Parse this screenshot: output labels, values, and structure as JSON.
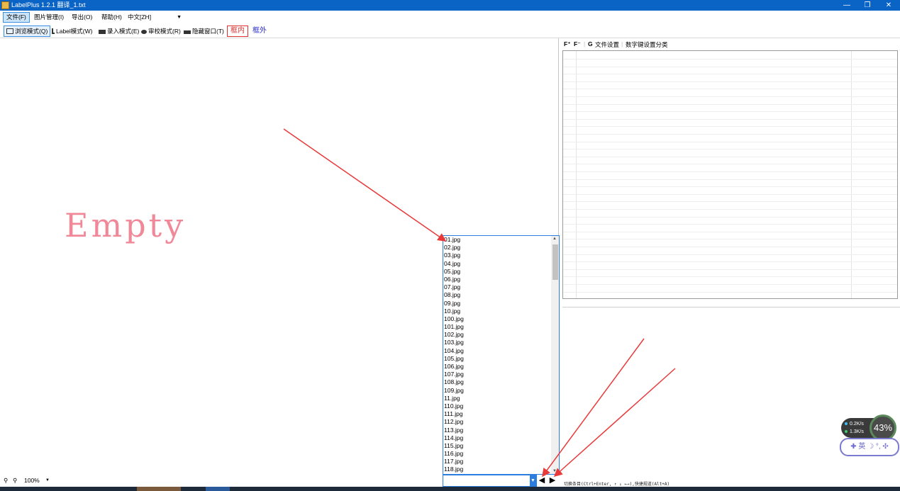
{
  "window": {
    "title": "LabelPlus 1.2.1 翻译_1.txt",
    "minimize": "—",
    "maximize": "❐",
    "close": "✕"
  },
  "menu": {
    "items": [
      "文件(F)",
      "图片管理(I)",
      "导出(O)",
      "帮助(H)"
    ],
    "language": "中文[ZH]"
  },
  "toolbar": {
    "modes": [
      "浏览模式(Q)",
      "Label模式(W)",
      "录入模式(E)",
      "审校模式(R)",
      "隐藏窗口(T)"
    ],
    "inner_label": "框内",
    "outer_label": "框外"
  },
  "canvas": {
    "empty_text": "Empty"
  },
  "file_list": {
    "files": [
      "01.jpg",
      "02.jpg",
      "03.jpg",
      "04.jpg",
      "05.jpg",
      "06.jpg",
      "07.jpg",
      "08.jpg",
      "09.jpg",
      "10.jpg",
      "100.jpg",
      "101.jpg",
      "102.jpg",
      "103.jpg",
      "104.jpg",
      "105.jpg",
      "106.jpg",
      "107.jpg",
      "108.jpg",
      "109.jpg",
      "11.jpg",
      "110.jpg",
      "111.jpg",
      "112.jpg",
      "113.jpg",
      "114.jpg",
      "115.jpg",
      "116.jpg",
      "117.jpg",
      "118.jpg"
    ]
  },
  "zoom": {
    "value": "100%"
  },
  "right_panel": {
    "file_settings": "文件设置",
    "numkey_settings": "数字键设置分类",
    "hint": "切换条目(Ctrl+Enter, ↑ ↓ ←→),快捷规道(Alt+A)"
  },
  "widget": {
    "upload": "0.2K/s",
    "download": "1.3K/s",
    "cpu": "43%",
    "ime": "✚ 英 ☽ °, ✣"
  },
  "colors": {
    "titlebar": "#0a64c6",
    "empty_text": "#f08898",
    "arrow": "#e83a3a",
    "selection_border": "#2b7de0"
  }
}
